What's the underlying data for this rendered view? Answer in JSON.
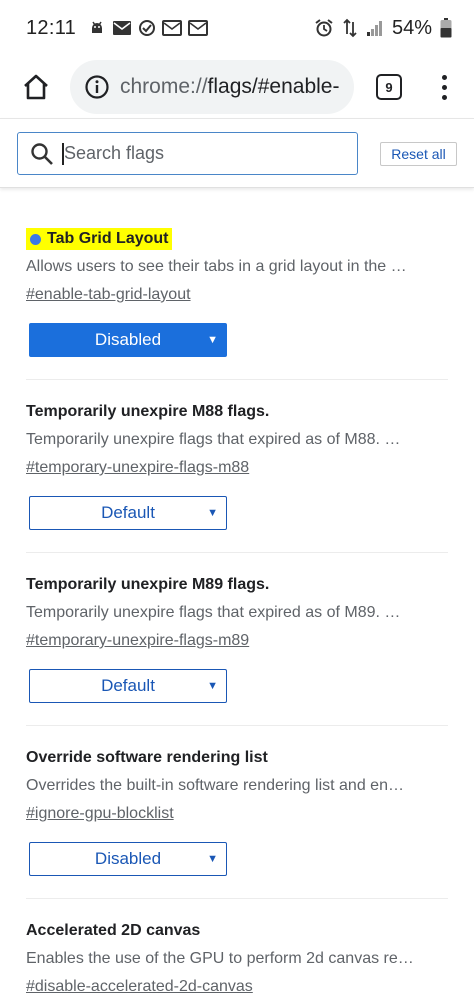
{
  "status_bar": {
    "time": "12:11",
    "battery": "54%",
    "left_icons": [
      "android-debug-icon",
      "mail-icon",
      "check-circle-icon",
      "mail-icon",
      "mail-icon"
    ],
    "right_icons": [
      "alarm-icon",
      "data-transfer-icon",
      "signal-icon",
      "battery-icon"
    ]
  },
  "toolbar": {
    "url_host": "chrome://",
    "url_path": "flags/#enable-",
    "tab_count": "9"
  },
  "search": {
    "placeholder": "Search flags",
    "reset_label": "Reset all"
  },
  "flags": [
    {
      "title": "Tab Grid Layout",
      "highlighted": true,
      "description": "Allows users to see their tabs in a grid layout in the …",
      "link": "#enable-tab-grid-layout",
      "value": "Disabled"
    },
    {
      "title": "Temporarily unexpire M88 flags.",
      "highlighted": false,
      "description": "Temporarily unexpire flags that expired as of M88. …",
      "link": "#temporary-unexpire-flags-m88",
      "value": "Default"
    },
    {
      "title": "Temporarily unexpire M89 flags.",
      "highlighted": false,
      "description": "Temporarily unexpire flags that expired as of M89. …",
      "link": "#temporary-unexpire-flags-m89",
      "value": "Default"
    },
    {
      "title": "Override software rendering list",
      "highlighted": false,
      "description": "Overrides the built-in software rendering list and en…",
      "link": "#ignore-gpu-blocklist",
      "value": "Disabled"
    },
    {
      "title": "Accelerated 2D canvas",
      "highlighted": false,
      "description": "Enables the use of the GPU to perform 2d canvas re…",
      "link": "#disable-accelerated-2d-canvas",
      "value": ""
    }
  ],
  "colors": {
    "accent": "#1b6fdc",
    "highlight": "#ffff00",
    "link_blue": "#1a57b5"
  }
}
